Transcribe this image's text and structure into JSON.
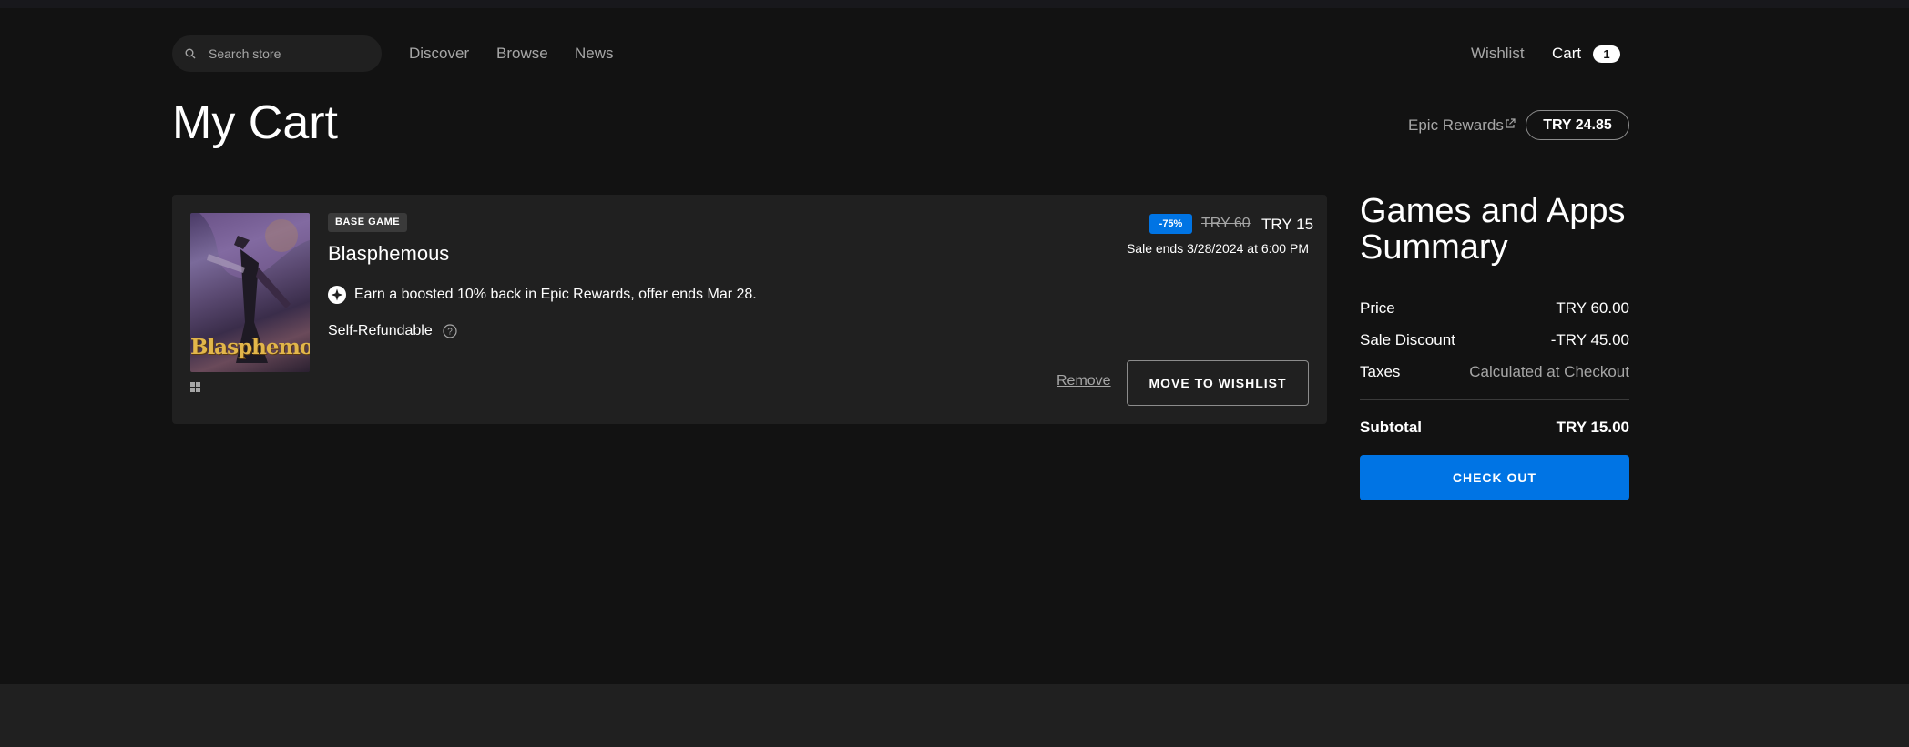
{
  "nav": {
    "search_placeholder": "Search store",
    "links": [
      "Discover",
      "Browse",
      "News"
    ],
    "wishlist": "Wishlist",
    "cart": "Cart",
    "cart_count": "1"
  },
  "page": {
    "title": "My Cart",
    "rewards_link": "Epic Rewards",
    "rewards_balance": "TRY 24.85"
  },
  "item": {
    "badge": "BASE GAME",
    "title": "Blasphemous",
    "cover_logo": "Blasphemous",
    "discount": "-75%",
    "original_price": "TRY 60",
    "sale_price": "TRY 15",
    "sale_ends": "Sale ends 3/28/2024 at 6:00 PM",
    "rewards_offer": "Earn a boosted 10% back in Epic Rewards, offer ends Mar 28.",
    "refund": "Self-Refundable",
    "remove": "Remove",
    "move_to_wishlist": "MOVE TO WISHLIST",
    "platform_icon": "windows-icon"
  },
  "summary": {
    "title": "Games and Apps Summary",
    "rows": [
      {
        "label": "Price",
        "value": "TRY 60.00"
      },
      {
        "label": "Sale Discount",
        "value": "-TRY 45.00"
      },
      {
        "label": "Taxes",
        "value": "Calculated at Checkout"
      }
    ],
    "subtotal_label": "Subtotal",
    "subtotal_value": "TRY 15.00",
    "checkout": "CHECK OUT"
  },
  "colors": {
    "background": "#121212",
    "card": "#202020",
    "accent": "#0074e4",
    "muted_text": "#a6a6a6"
  }
}
